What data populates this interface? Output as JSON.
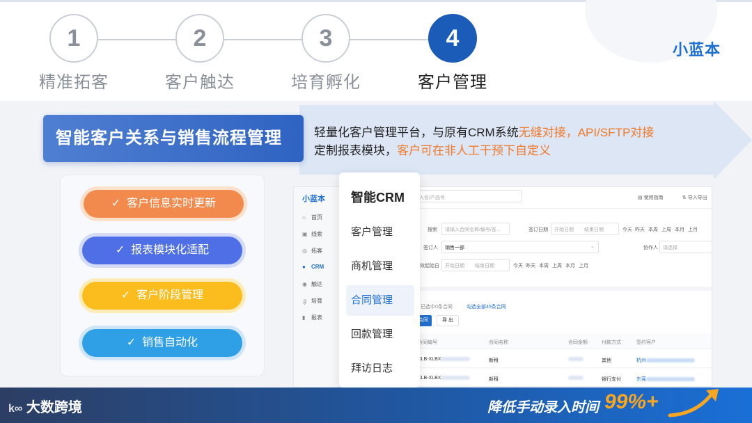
{
  "brand": "小蓝本",
  "steps": [
    {
      "num": "1",
      "label": "精准拓客"
    },
    {
      "num": "2",
      "label": "客户触达"
    },
    {
      "num": "3",
      "label": "培育孵化"
    },
    {
      "num": "4",
      "label": "客户管理"
    }
  ],
  "active_step": 4,
  "section_title": "智能客户关系与销售流程管理",
  "desc": {
    "line1_a": "轻量化客户管理平台，与原有CRM系统",
    "line1_hl": "无缝对接，API/SFTP对接",
    "line2_a": "定制报表模块，",
    "line2_hl": "客户可在非人工干预下自定义"
  },
  "features": [
    {
      "label": "客户信息实时更新",
      "color": "#f28a4e"
    },
    {
      "label": "报表模块化适配",
      "color": "#4f6fe6"
    },
    {
      "label": "客户阶段管理",
      "color": "#fbbd1e"
    },
    {
      "label": "销售自动化",
      "color": "#2f9fe6"
    }
  ],
  "check_icon": "✓",
  "crm": {
    "logo": "小蓝本",
    "nav": [
      {
        "icon": "⌂",
        "label": "首页"
      },
      {
        "icon": "▣",
        "label": "线索"
      },
      {
        "icon": "◎",
        "label": "拓客"
      },
      {
        "icon": "●",
        "label": "CRM"
      },
      {
        "icon": "◉",
        "label": "触达"
      },
      {
        "icon": "ℊ",
        "label": "培育"
      },
      {
        "icon": "▮",
        "label": "报表"
      }
    ],
    "search_placeholder": "入名/产品号",
    "guide": "使用指南",
    "export": "导入导出",
    "filter_search": "搜索",
    "filter_search_ph": "请输入合同名称/编号/签...",
    "sign_date": "签订日期",
    "start_date": "开始日期",
    "end_date": "结束日期",
    "quick_dates": [
      "今天",
      "昨天",
      "本周",
      "上周",
      "本月",
      "上月"
    ],
    "signer": "签订人",
    "signer_val": "销售一部",
    "helper": "协作人",
    "helper_ph": "请选择",
    "effective": "生效起始日",
    "selected": "合同 已选中0条合同",
    "select_all": "勾选全部45条合同",
    "btn_new": "新增合同",
    "btn_export": "导 出",
    "cols": [
      "合同编号",
      "合同名称",
      "合同金额",
      "付款方式",
      "签约客户"
    ],
    "rows": [
      {
        "no": "XLB-XLBX",
        "name": "新租",
        "pay": "其他",
        "cust": "杭州"
      },
      {
        "no": "XLB-XLBX",
        "name": "新租",
        "pay": "银行支付",
        "cust": "东莞"
      }
    ]
  },
  "menu": {
    "title": "智能CRM",
    "items": [
      "客户管理",
      "商机管理",
      "合同管理",
      "回款管理",
      "拜访日志"
    ],
    "selected": "合同管理"
  },
  "footer": {
    "logo": "大数跨境",
    "slogan": "降低手动录入时间",
    "percent": "99%+"
  }
}
